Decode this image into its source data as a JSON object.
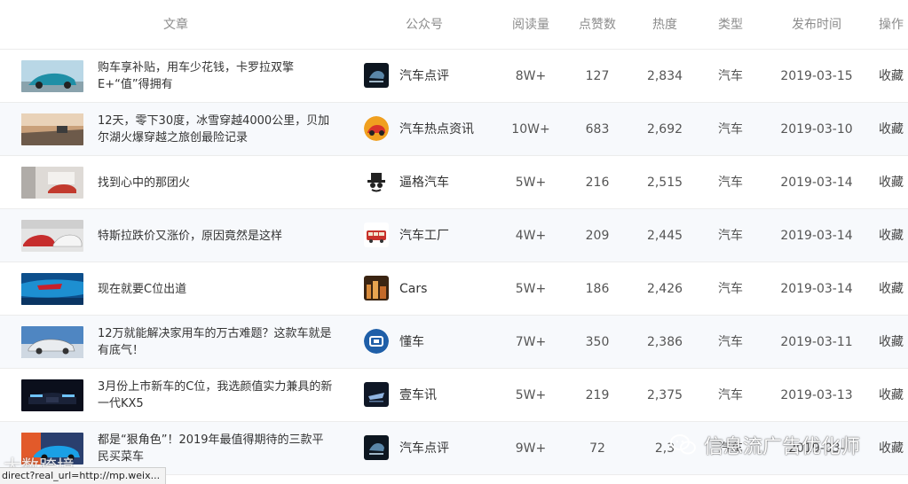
{
  "colors": {
    "header_text": "#8c8c8c",
    "row_alt_bg": "#f7f9fc",
    "divider": "#ececec"
  },
  "columns": {
    "article": "文章",
    "account": "公众号",
    "reads": "阅读量",
    "likes": "点赞数",
    "heat": "热度",
    "type": "类型",
    "date": "发布时间",
    "action": "操作"
  },
  "rows": [
    {
      "title": "购车享补贴，用车少花钱，卡罗拉双擎E+“值”得拥有",
      "thumb": "teal-car-thumb",
      "account": "汽车点评",
      "account_icon": "car-review-logo-icon",
      "reads": "8W+",
      "likes": "127",
      "heat": "2,834",
      "type": "汽车",
      "date": "2019-03-15",
      "action": "收藏"
    },
    {
      "title": "12天，零下30度，冰雪穿越4000公里，贝加尔湖火爆穿越之旅创最险记录",
      "thumb": "snow-road-thumb",
      "account": "汽车热点资讯",
      "account_icon": "orange-car-avatar-icon",
      "reads": "10W+",
      "likes": "683",
      "heat": "2,692",
      "type": "汽车",
      "date": "2019-03-10",
      "action": "收藏"
    },
    {
      "title": "找到心中的那团火",
      "thumb": "showroom-thumb",
      "account": "逼格汽车",
      "account_icon": "hat-glasses-icon",
      "reads": "5W+",
      "likes": "216",
      "heat": "2,515",
      "type": "汽车",
      "date": "2019-03-14",
      "action": "收藏"
    },
    {
      "title": "特斯拉跌价又涨价，原因竟然是这样",
      "thumb": "tesla-thumb",
      "account": "汽车工厂",
      "account_icon": "red-bus-icon",
      "reads": "4W+",
      "likes": "209",
      "heat": "2,445",
      "type": "汽车",
      "date": "2019-03-14",
      "action": "收藏"
    },
    {
      "title": "现在就要C位出道",
      "thumb": "blue-taillight-thumb",
      "account": "Cars",
      "account_icon": "city-night-icon",
      "reads": "5W+",
      "likes": "186",
      "heat": "2,426",
      "type": "汽车",
      "date": "2019-03-14",
      "action": "收藏"
    },
    {
      "title": "12万就能解决家用车的万古难题？这款车就是有底气！",
      "thumb": "sky-car-thumb",
      "account": "懂车",
      "account_icon": "dongche-logo-icon",
      "reads": "7W+",
      "likes": "350",
      "heat": "2,386",
      "type": "汽车",
      "date": "2019-03-11",
      "action": "收藏"
    },
    {
      "title": "3月份上市新车的C位，我选颜值实力兼具的新一代KX5",
      "thumb": "dark-car-front-thumb",
      "account": "壹车讯",
      "account_icon": "yichexun-logo-icon",
      "reads": "5W+",
      "likes": "219",
      "heat": "2,375",
      "type": "汽车",
      "date": "2019-03-13",
      "action": "收藏"
    },
    {
      "title": "都是“狠角色”！2019年最值得期待的三款平民买菜车",
      "thumb": "blue-sports-car-thumb",
      "account": "汽车点评",
      "account_icon": "car-review-logo-icon",
      "reads": "9W+",
      "likes": "72",
      "heat": "2,3",
      "type": "汽车",
      "date": "2019-03-",
      "action": "收藏"
    }
  ],
  "statusbar": {
    "text": "direct?real_url=http://mp.weix..."
  },
  "watermark_left": {
    "text": "大数跨境"
  },
  "watermark_right": {
    "text": "信息流广告优化师"
  }
}
